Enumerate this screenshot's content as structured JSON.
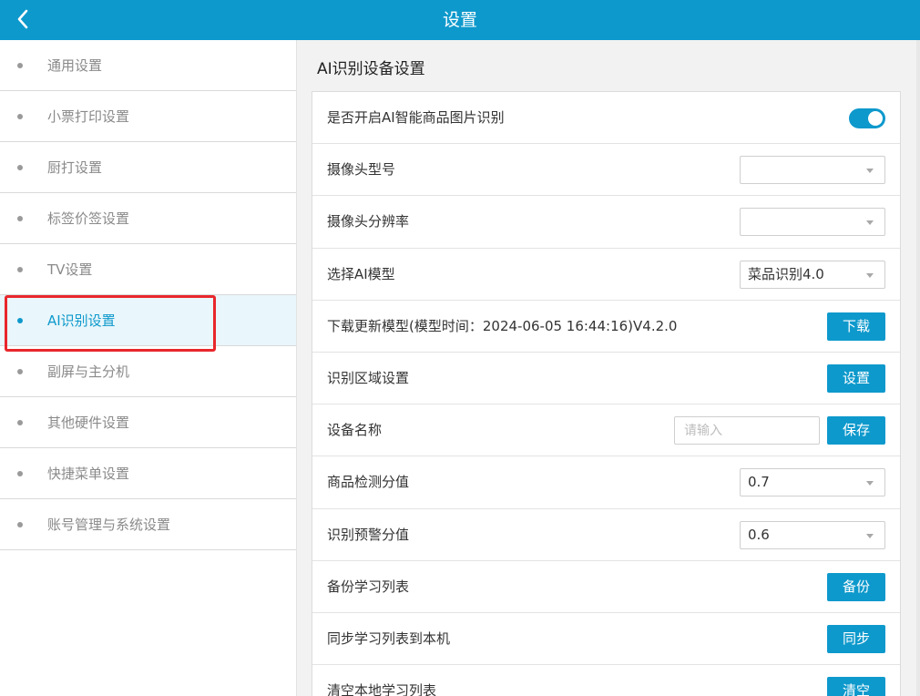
{
  "header": {
    "title": "设置",
    "back_icon": "chevron-left-icon"
  },
  "sidebar": {
    "items": [
      {
        "label": "通用设置",
        "active": false
      },
      {
        "label": "小票打印设置",
        "active": false
      },
      {
        "label": "厨打设置",
        "active": false
      },
      {
        "label": "标签价签设置",
        "active": false
      },
      {
        "label": "TV设置",
        "active": false
      },
      {
        "label": "AI识别设置",
        "active": true
      },
      {
        "label": "副屏与主分机",
        "active": false
      },
      {
        "label": "其他硬件设置",
        "active": false
      },
      {
        "label": "快捷菜单设置",
        "active": false
      },
      {
        "label": "账号管理与系统设置",
        "active": false
      }
    ]
  },
  "main": {
    "section_title": "AI识别设备设置",
    "rows": {
      "enable_ai": {
        "label": "是否开启AI智能商品图片识别",
        "enabled": true
      },
      "camera_model": {
        "label": "摄像头型号",
        "value": ""
      },
      "camera_resolution": {
        "label": "摄像头分辨率",
        "value": ""
      },
      "ai_model": {
        "label": "选择AI模型",
        "value": "菜品识别4.0"
      },
      "download_model": {
        "label": "下载更新模型(模型时间：2024-06-05 16:44:16)V4.2.0",
        "button": "下载"
      },
      "recognition_area": {
        "label": "识别区域设置",
        "button": "设置"
      },
      "device_name": {
        "label": "设备名称",
        "placeholder": "请输入",
        "value": "",
        "button": "保存"
      },
      "detection_threshold": {
        "label": "商品检测分值",
        "value": "0.7"
      },
      "warning_threshold": {
        "label": "识别预警分值",
        "value": "0.6"
      },
      "backup_list": {
        "label": "备份学习列表",
        "button": "备份"
      },
      "sync_list": {
        "label": "同步学习列表到本机",
        "button": "同步"
      },
      "clear_list": {
        "label": "清空本地学习列表",
        "button": "清空"
      }
    }
  },
  "colors": {
    "accent": "#0e99cc",
    "highlight": "#e8272c"
  }
}
